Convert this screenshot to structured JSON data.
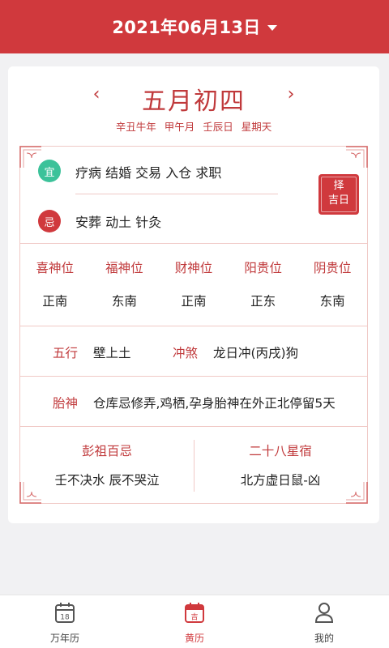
{
  "header": {
    "date": "2021年06月13日"
  },
  "lunar": {
    "title": "五月初四",
    "prev": "‹",
    "next": "›",
    "ganzhi": [
      "辛丑牛年",
      "甲午月",
      "壬辰日",
      "星期天"
    ]
  },
  "yiji": {
    "yi_label": "宜",
    "yi_text": "疗病 结婚 交易 入仓 求职",
    "ji_label": "忌",
    "ji_text": "安葬 动土 针灸",
    "choose_day": [
      "择",
      "吉日"
    ]
  },
  "gods": [
    {
      "name": "喜神位",
      "dir": "正南"
    },
    {
      "name": "福神位",
      "dir": "东南"
    },
    {
      "name": "财神位",
      "dir": "正南"
    },
    {
      "name": "阳贵位",
      "dir": "正东"
    },
    {
      "name": "阴贵位",
      "dir": "东南"
    }
  ],
  "wuxing": {
    "label": "五行",
    "value": "壁上土",
    "chong_label": "冲煞",
    "chong_value": "龙日冲(丙戌)狗"
  },
  "taishen": {
    "label": "胎神",
    "value": "仓库忌修弄,鸡栖,孕身胎神在外正北停留5天"
  },
  "pengzu": {
    "title": "彭祖百忌",
    "value": "壬不决水 辰不哭泣"
  },
  "xingxiu": {
    "title": "二十八星宿",
    "value": "北方虚日鼠-凶"
  },
  "tabs": [
    {
      "label": "万年历",
      "icon": "calendar-18-icon",
      "icon_text": "18",
      "active": false
    },
    {
      "label": "黄历",
      "icon": "almanac-icon",
      "icon_text": "吉",
      "active": true
    },
    {
      "label": "我的",
      "icon": "user-icon",
      "active": false
    }
  ],
  "colors": {
    "primary": "#d0393d",
    "yi_green": "#3cc29a",
    "border_pink": "#f0c9c6"
  }
}
